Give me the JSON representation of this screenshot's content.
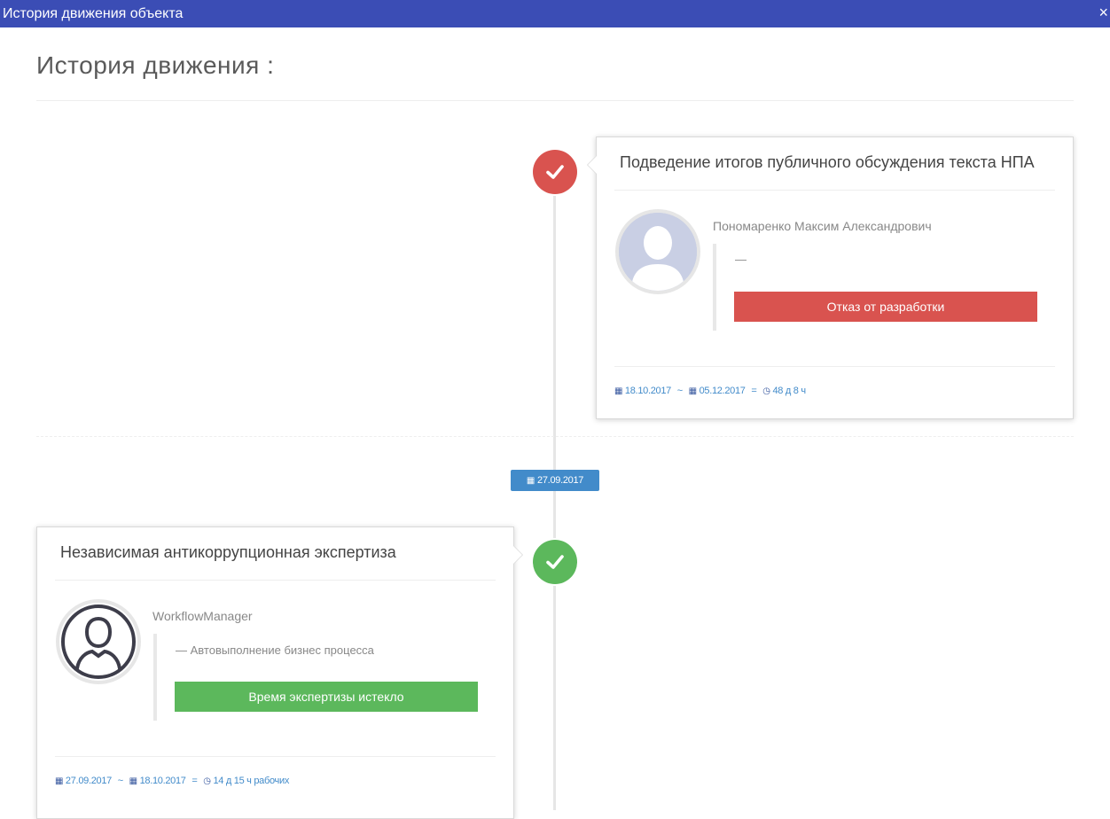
{
  "window": {
    "title": "История движения объекта",
    "close_glyph": "×"
  },
  "page": {
    "heading": "История движения :"
  },
  "timeline": {
    "date_separator": "27.09.2017",
    "entries": [
      {
        "status_color": "#d9534f",
        "icon": "check-icon",
        "title": "Подведение итогов публичного обсуждения текста НПА",
        "user": "Пономаренко Максим Александрович",
        "comment": "—",
        "status_label": "Отказ от разработки",
        "start_date": "18.10.2017",
        "end_date": "05.12.2017",
        "duration": "48 д 8 ч",
        "range_sep": "~",
        "dur_sep": "="
      },
      {
        "status_color": "#5cb85c",
        "icon": "check-icon",
        "title": "Независимая антикоррупционная экспертиза",
        "user": "WorkflowManager",
        "comment": "— Автовыполнение бизнес процесса",
        "status_label": "Время экспертизы истекло",
        "start_date": "27.09.2017",
        "end_date": "18.10.2017",
        "duration": "14 д 15 ч рабочих",
        "range_sep": "~",
        "dur_sep": "="
      }
    ]
  }
}
